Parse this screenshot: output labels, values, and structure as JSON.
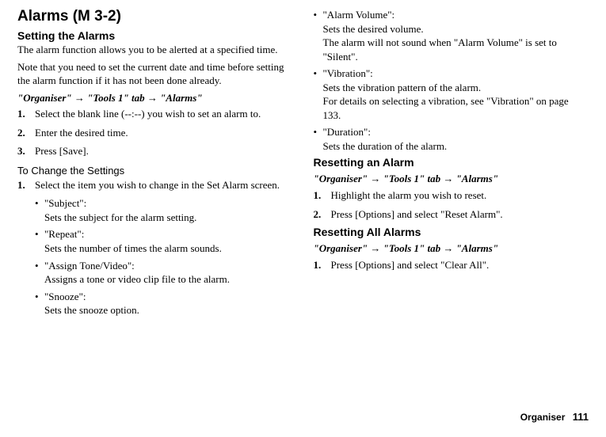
{
  "title_main": "Alarms",
  "title_shortcut": "(M 3-2)",
  "footer_label": "Organiser",
  "footer_page": "111",
  "left": {
    "h2_setting": "Setting the Alarms",
    "p_intro1": "The alarm function allows you to be alerted at a specified time.",
    "p_intro2": "Note that you need to set the current date and time before setting the alarm function if it has not been done already.",
    "nav1_a": "\"Organiser\"",
    "nav1_b": "\"Tools 1\" tab",
    "nav1_c": "\"Alarms\"",
    "step1": "Select the blank line (--:--) you wish to set an alarm to.",
    "step2": "Enter the desired time.",
    "step3": "Press [Save].",
    "h3_change": "To Change the Settings",
    "change_step1": "Select the item you wish to change in the Set Alarm screen.",
    "sub_subject_t": "\"Subject\":",
    "sub_subject_d": "Sets the subject for the alarm setting.",
    "sub_repeat_t": "\"Repeat\":",
    "sub_repeat_d": "Sets the number of times the alarm sounds.",
    "sub_assign_t": "\"Assign Tone/Video\":",
    "sub_assign_d": "Assigns a tone or video clip file to the alarm.",
    "sub_snooze_t": "\"Snooze\":",
    "sub_snooze_d": "Sets the snooze option."
  },
  "right": {
    "sub_volume_t": "\"Alarm Volume\":",
    "sub_volume_d1": "Sets the desired volume.",
    "sub_volume_d2": "The alarm will not sound when \"Alarm Volume\" is set to \"Silent\".",
    "sub_vibration_t": "\"Vibration\":",
    "sub_vibration_d1": "Sets the vibration pattern of the alarm.",
    "sub_vibration_d2": "For details on selecting a vibration, see \"Vibration\" on page 133.",
    "sub_duration_t": "\"Duration\":",
    "sub_duration_d": "Sets the duration of the alarm.",
    "h2_reset": "Resetting an Alarm",
    "nav2_a": "\"Organiser\"",
    "nav2_b": "\"Tools 1\" tab",
    "nav2_c": "\"Alarms\"",
    "reset_step1": "Highlight the alarm you wish to reset.",
    "reset_step2": "Press [Options] and select \"Reset Alarm\".",
    "h2_resetall": "Resetting All Alarms",
    "nav3_a": "\"Organiser\"",
    "nav3_b": "\"Tools 1\" tab",
    "nav3_c": "\"Alarms\"",
    "resetall_step1": "Press [Options] and select \"Clear All\"."
  }
}
